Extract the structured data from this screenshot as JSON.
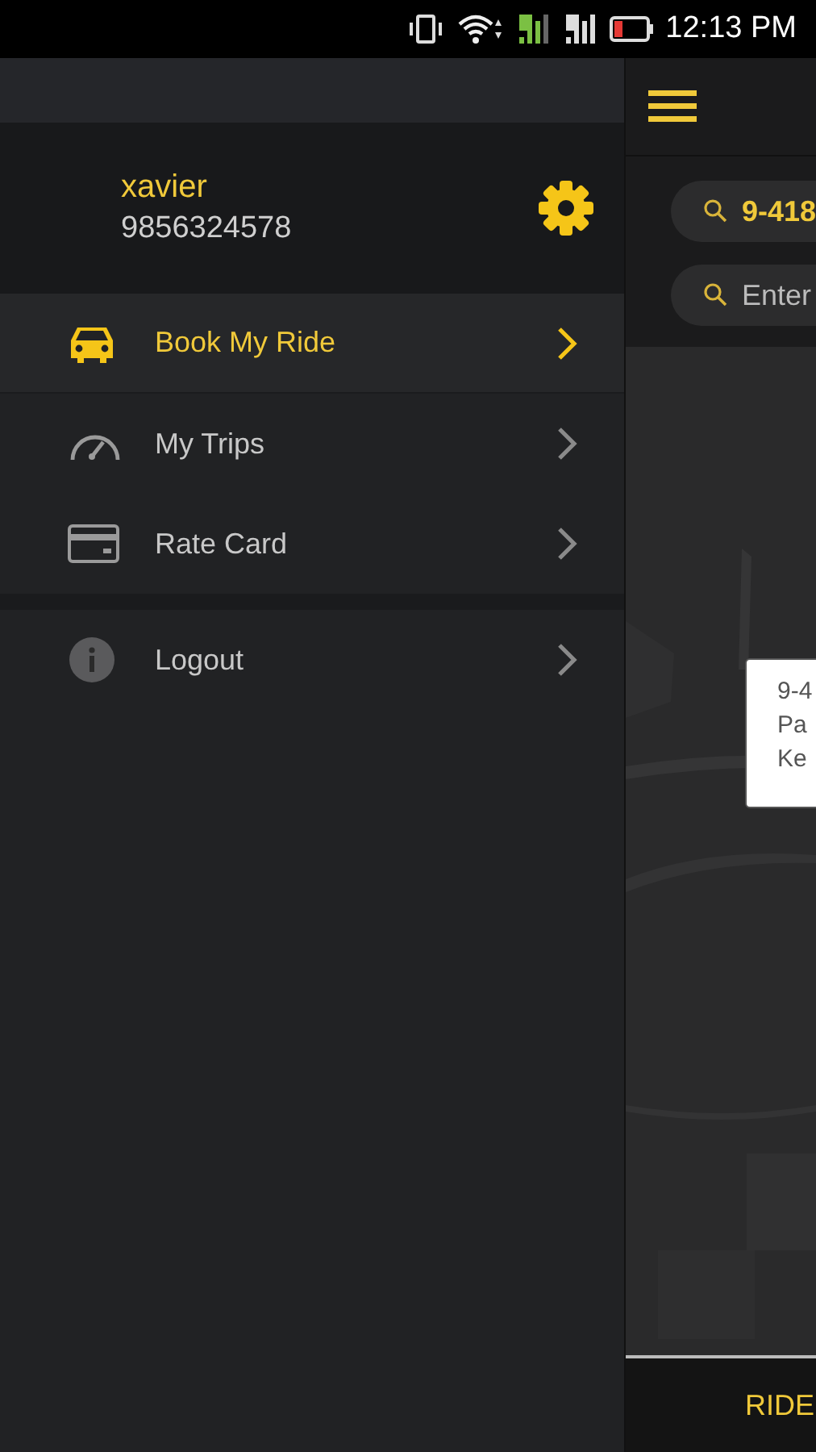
{
  "status_bar": {
    "time": "12:13 PM"
  },
  "drawer": {
    "user": {
      "name": "xavier",
      "phone": "9856324578"
    },
    "sections": [
      {
        "items": [
          {
            "label": "Book My Ride",
            "kind": "car",
            "selected": true
          },
          {
            "label": "My Trips",
            "kind": "gauge",
            "selected": false
          },
          {
            "label": "Rate Card",
            "kind": "card",
            "selected": false
          }
        ]
      },
      {
        "items": [
          {
            "label": "Logout",
            "kind": "info",
            "selected": false
          }
        ]
      }
    ]
  },
  "main": {
    "pickup": {
      "value": "9-418"
    },
    "drop": {
      "placeholder": "Enter"
    },
    "map": {
      "popup": {
        "lines": [
          "9-4",
          "Pa",
          "Ke"
        ]
      }
    },
    "bottom_bar": {
      "label": "RIDE"
    }
  }
}
